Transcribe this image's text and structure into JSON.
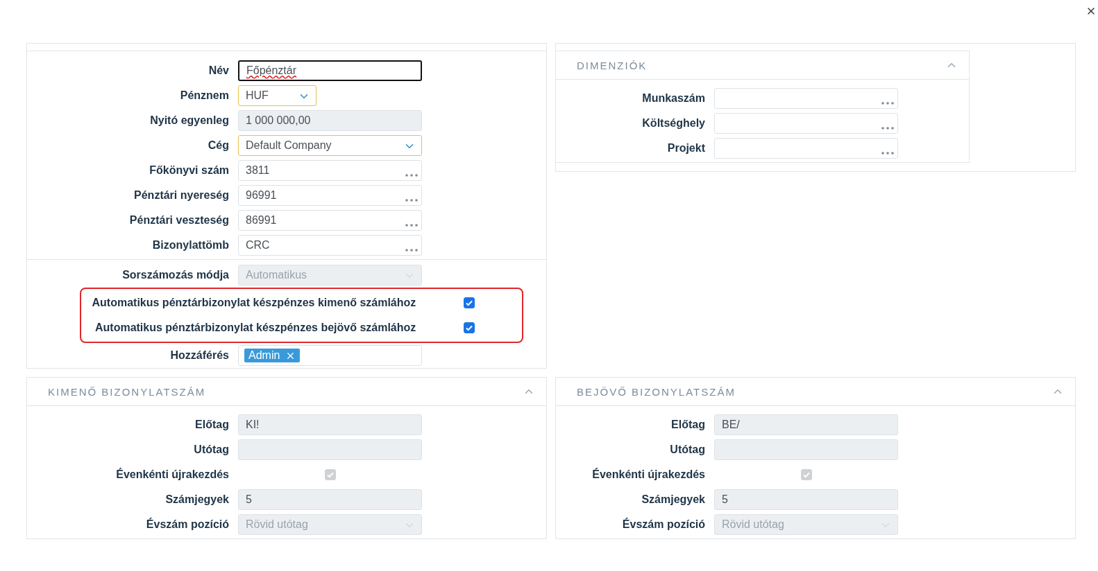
{
  "main": {
    "groups": [
      {
        "ruled": false,
        "highlighted": false,
        "fields": [
          {
            "kind": "text",
            "label": "Név",
            "value": "Főpénztár",
            "focused": true,
            "misspelled": true,
            "disabled": false
          },
          {
            "kind": "select",
            "label": "Pénznem",
            "value": "HUF",
            "required": true,
            "disabled": false,
            "short": true
          },
          {
            "kind": "text",
            "label": "Nyitó egyenleg",
            "value": "1 000 000,00",
            "focused": false,
            "disabled": true
          },
          {
            "kind": "select",
            "label": "Cég",
            "value": "Default Company",
            "required": true,
            "disabled": false,
            "short": false
          },
          {
            "kind": "lookup",
            "label": "Főkönyvi szám",
            "value": "3811"
          },
          {
            "kind": "lookup",
            "label": "Pénztári nyereség",
            "value": "96991"
          },
          {
            "kind": "lookup",
            "label": "Pénztári veszteség",
            "value": "86991"
          },
          {
            "kind": "lookup",
            "label": "Bizonylattömb",
            "value": "CRC"
          }
        ]
      },
      {
        "ruled": true,
        "highlighted": false,
        "fields": [
          {
            "kind": "select",
            "label": "Sorszámozás módja",
            "value": "Automatikus",
            "required": false,
            "disabled": true,
            "short": false
          }
        ]
      },
      {
        "ruled": false,
        "highlighted": true,
        "fields": [
          {
            "kind": "wide_checkbox",
            "label": "Automatikus pénztárbizonylat készpénzes kimenő számlához",
            "checked": true,
            "disabled": false
          },
          {
            "kind": "wide_checkbox",
            "label": "Automatikus pénztárbizonylat készpénzes bejövő számlához",
            "checked": true,
            "disabled": false
          }
        ]
      },
      {
        "ruled": false,
        "highlighted": false,
        "fields": [
          {
            "kind": "tags",
            "label": "Hozzáférés",
            "tags": [
              "Admin"
            ]
          }
        ]
      }
    ]
  },
  "dimensions": {
    "title": "DIMENZIÓK",
    "expanded": true,
    "fields": [
      {
        "kind": "lookup",
        "label": "Munkaszám"
      },
      {
        "kind": "lookup",
        "label": "Költséghely"
      },
      {
        "kind": "lookup",
        "label": "Projekt"
      }
    ]
  },
  "panels": [
    {
      "title": "KIMENŐ BIZONYLATSZÁM",
      "expanded": true,
      "fields": [
        {
          "kind": "text",
          "label": "Előtag",
          "value": "KI!",
          "focused": false,
          "disabled": true
        },
        {
          "kind": "text",
          "label": "Utótag",
          "focused": false,
          "disabled": true
        },
        {
          "kind": "checkbox",
          "label": "Évenkénti újrakezdés",
          "checked": true,
          "disabled": true
        },
        {
          "kind": "text",
          "label": "Számjegyek",
          "value": "5",
          "focused": false,
          "disabled": true
        },
        {
          "kind": "select",
          "label": "Évszám pozíció",
          "value": "Rövid utótag",
          "required": false,
          "disabled": true,
          "short": false
        }
      ]
    },
    {
      "title": "BEJÖVŐ BIZONYLATSZÁM",
      "expanded": true,
      "fields": [
        {
          "kind": "text",
          "label": "Előtag",
          "value": "BE/",
          "focused": false,
          "disabled": true
        },
        {
          "kind": "text",
          "label": "Utótag",
          "focused": false,
          "disabled": true
        },
        {
          "kind": "checkbox",
          "label": "Évenkénti újrakezdés",
          "checked": true,
          "disabled": true
        },
        {
          "kind": "text",
          "label": "Számjegyek",
          "value": "5",
          "focused": false,
          "disabled": true
        },
        {
          "kind": "select",
          "label": "Évszám pozíció",
          "value": "Rövid utótag",
          "required": false,
          "disabled": true,
          "short": false
        }
      ]
    }
  ]
}
